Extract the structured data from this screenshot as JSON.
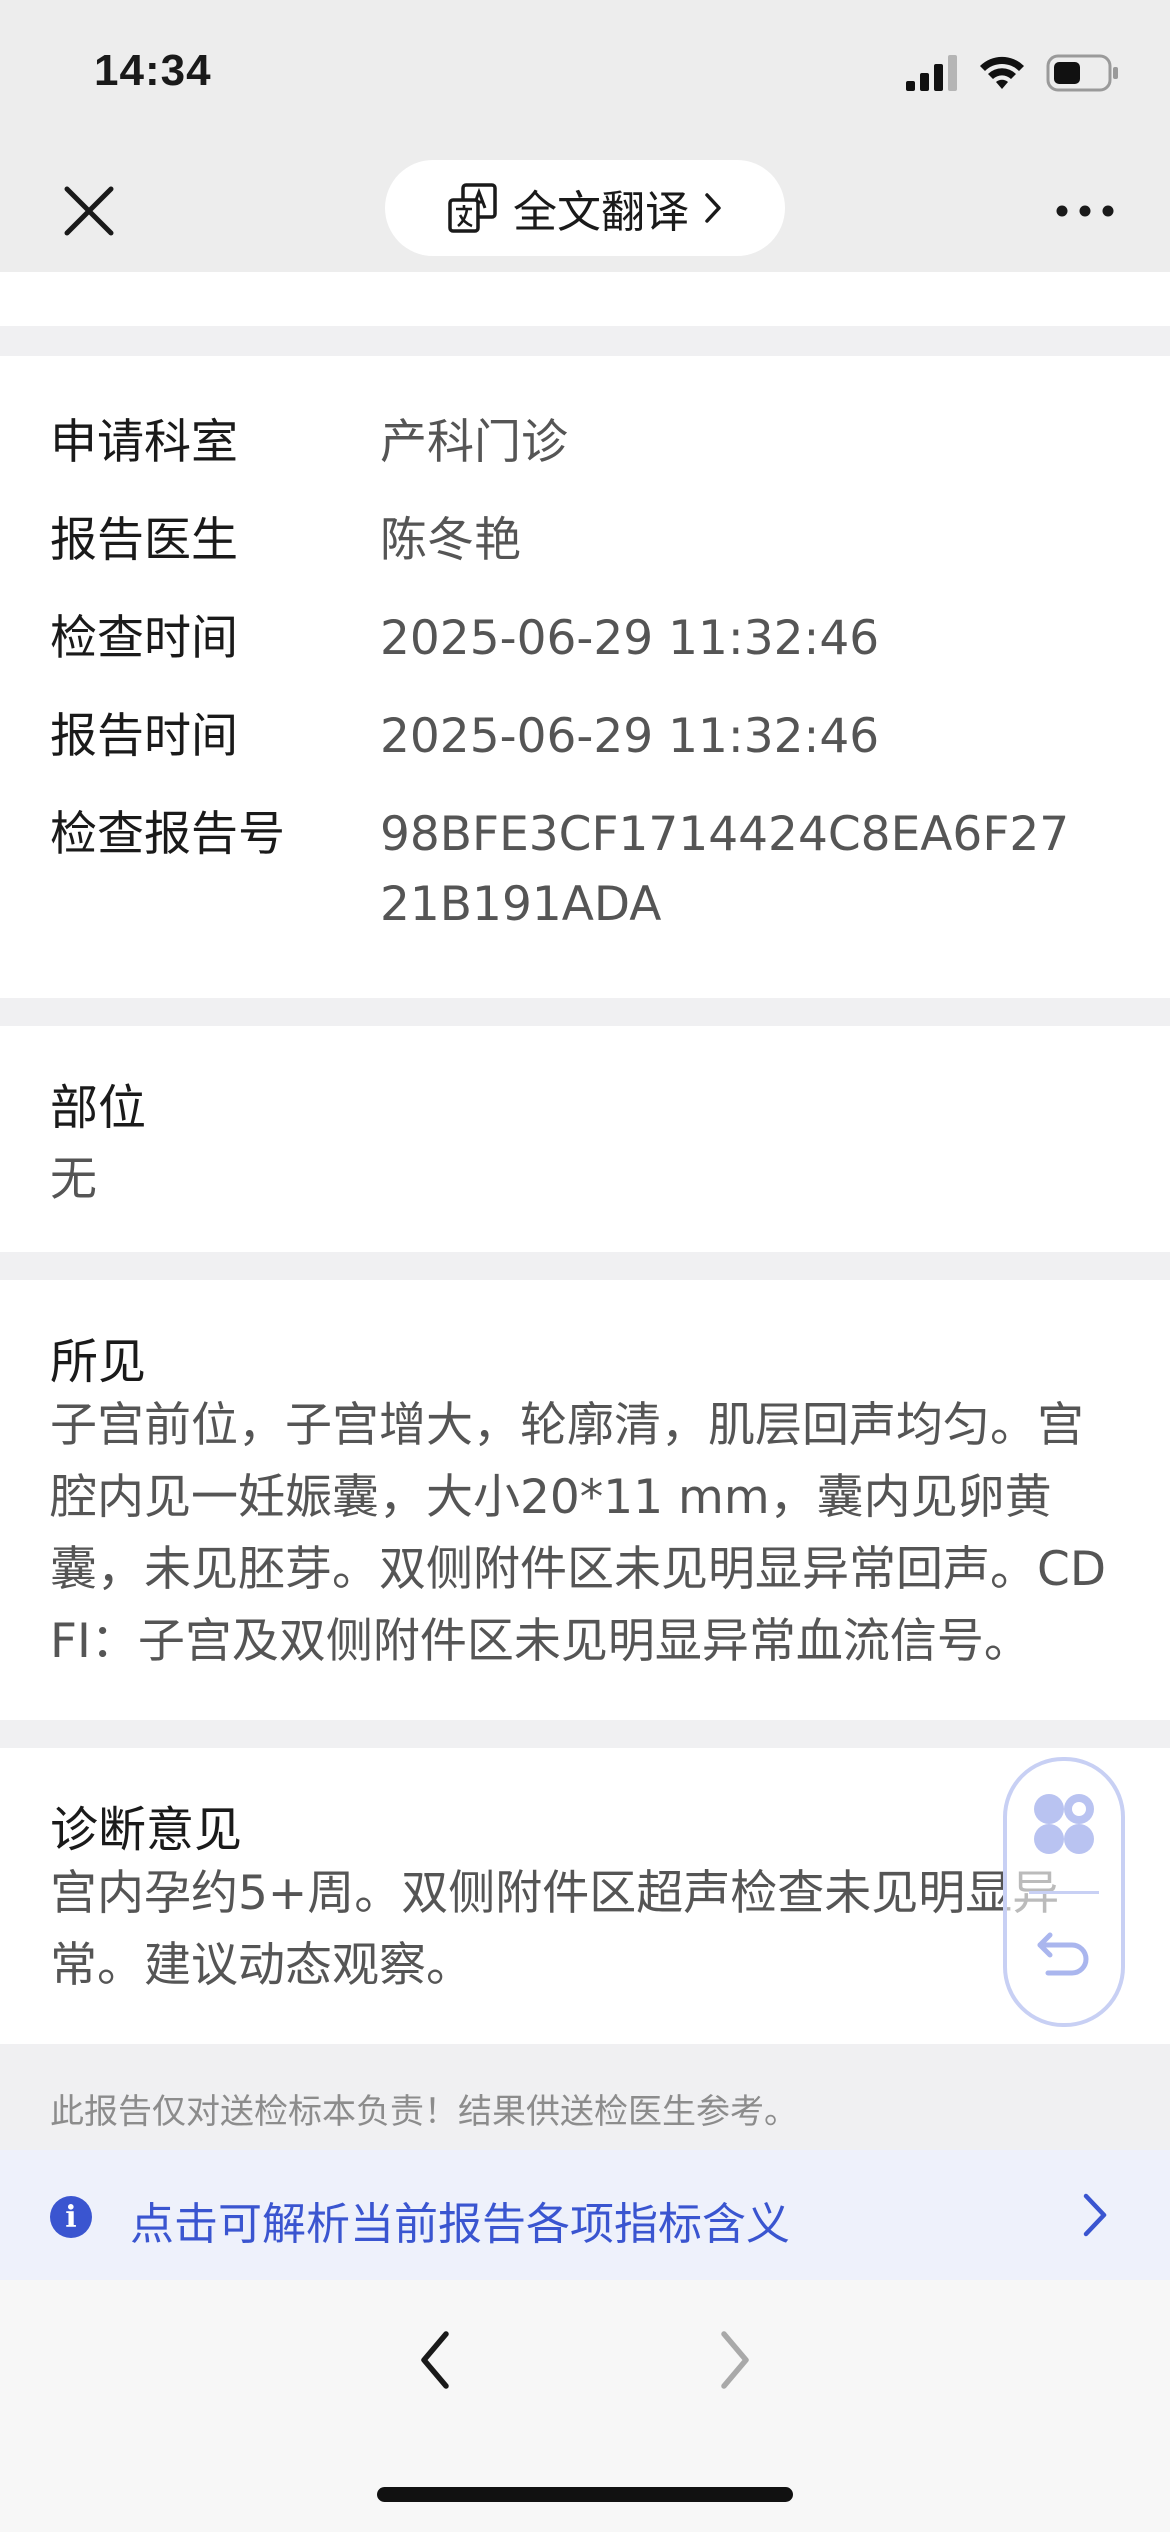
{
  "status_bar": {
    "time": "14:34"
  },
  "nav": {
    "translate_label": "全文翻译",
    "icons": {
      "close": "close-icon",
      "translate": "translate-icon",
      "chevron": "chevron-right-icon",
      "more": "more-icon"
    }
  },
  "report_info": {
    "rows": [
      {
        "label": "申请科室",
        "value": "产科门诊"
      },
      {
        "label": "报告医生",
        "value": "陈冬艳"
      },
      {
        "label": "检查时间",
        "value": "2025-06-29 11:32:46"
      },
      {
        "label": "报告时间",
        "value": "2025-06-29 11:32:46"
      },
      {
        "label": "检查报告号",
        "value": "98BFE3CF1714424C8EA6F2721B191ADA"
      }
    ]
  },
  "site_section": {
    "title": "部位",
    "body": "无"
  },
  "findings_section": {
    "title": "所见",
    "body": "子宫前位，子宫增大，轮廓清，肌层回声均匀。宫腔内见一妊娠囊，大小20*11 mm，囊内见卵黄囊，未见胚芽。双侧附件区未见明显异常回声。CDFI：子宫及双侧附件区未见明显异常血流信号。"
  },
  "diagnosis_section": {
    "title": "诊断意见",
    "body": "宫内孕约5+周。双侧附件区超声检查未见明显异常。建议动态观察。"
  },
  "disclaimer": "此报告仅对送检标本负责！结果供送检医生参考。",
  "hint": {
    "text": "点击可解析当前报告各项指标含义",
    "info_glyph": "i"
  },
  "colors": {
    "accent": "#3a55d0",
    "hint_bg": "#eef1fb",
    "page_bg": "#f0f0f2",
    "label_text": "#1a1a1a",
    "value_text": "#555555"
  }
}
